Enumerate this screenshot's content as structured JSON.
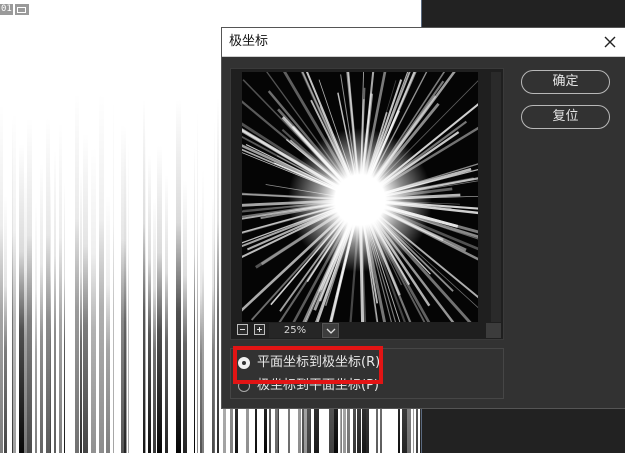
{
  "document": {
    "tag_text": "01"
  },
  "dialog": {
    "title": "极坐标",
    "ok_label": "确定",
    "reset_label": "复位",
    "zoom": {
      "value": "25%"
    },
    "options": [
      {
        "label": "平面坐标到极坐标(R)",
        "selected": true
      },
      {
        "label": "极坐标到平面坐标(P)",
        "selected": false
      }
    ]
  },
  "colors": {
    "highlight": "#e21414",
    "dialog_bg": "#323232",
    "titlebar_bg": "#ffffff"
  },
  "icons": [
    "close-icon",
    "zoom-out-icon",
    "zoom-in-icon",
    "chevron-down-icon",
    "radio-icon"
  ]
}
